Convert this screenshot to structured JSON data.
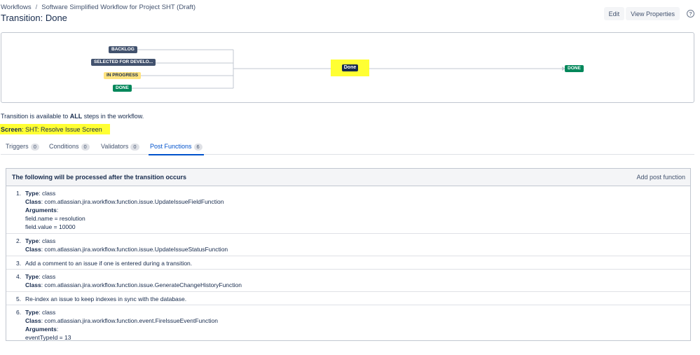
{
  "breadcrumb": {
    "root": "Workflows",
    "separator": "/",
    "current": "Software Simplified Workflow for Project SHT (Draft)"
  },
  "page_title": "Transition: Done",
  "actions": {
    "edit_label": "Edit",
    "view_properties_label": "View Properties",
    "help_glyph": "?"
  },
  "diagram": {
    "source_statuses": [
      {
        "label": "BACKLOG",
        "color": "#42526e"
      },
      {
        "label": "SELECTED FOR DEVELO...",
        "color": "#42526e"
      },
      {
        "label": "IN PROGRESS",
        "color": "#ffe380"
      },
      {
        "label": "DONE",
        "color": "#00875a"
      }
    ],
    "transition_label": "Done",
    "highlight_color": "#ffff33",
    "target_status": {
      "label": "DONE",
      "color": "#00875a"
    }
  },
  "availability": {
    "prefix": "Transition is available to ",
    "emphasis": "ALL",
    "suffix": " steps in the workflow."
  },
  "screen": {
    "label": "Screen",
    "value": ": SHT: Resolve Issue Screen"
  },
  "tabs": [
    {
      "label": "Triggers",
      "count": "0"
    },
    {
      "label": "Conditions",
      "count": "0"
    },
    {
      "label": "Validators",
      "count": "0"
    },
    {
      "label": "Post Functions",
      "count": "6",
      "active": true
    }
  ],
  "post_functions": {
    "title": "The following will be processed after the transition occurs",
    "add_label": "Add post function",
    "labels": {
      "type": "Type",
      "class": "Class",
      "arguments": "Arguments"
    },
    "items": [
      {
        "num": "1.",
        "type": ": class",
        "class": ": com.atlassian.jira.workflow.function.issue.UpdateIssueFieldFunction",
        "arguments_suffix": ":",
        "args": [
          "field.name = resolution",
          "field.value = 10000"
        ]
      },
      {
        "num": "2.",
        "type": ": class",
        "class": ": com.atlassian.jira.workflow.function.issue.UpdateIssueStatusFunction"
      },
      {
        "num": "3.",
        "text": "Add a comment to an issue if one is entered during a transition."
      },
      {
        "num": "4.",
        "type": ": class",
        "class": ": com.atlassian.jira.workflow.function.issue.GenerateChangeHistoryFunction"
      },
      {
        "num": "5.",
        "text": "Re-index an issue to keep indexes in sync with the database."
      },
      {
        "num": "6.",
        "type": ": class",
        "class": ": com.atlassian.jira.workflow.function.event.FireIssueEventFunction",
        "arguments_suffix": ":",
        "args": [
          "eventTypeId = 13"
        ]
      }
    ]
  }
}
